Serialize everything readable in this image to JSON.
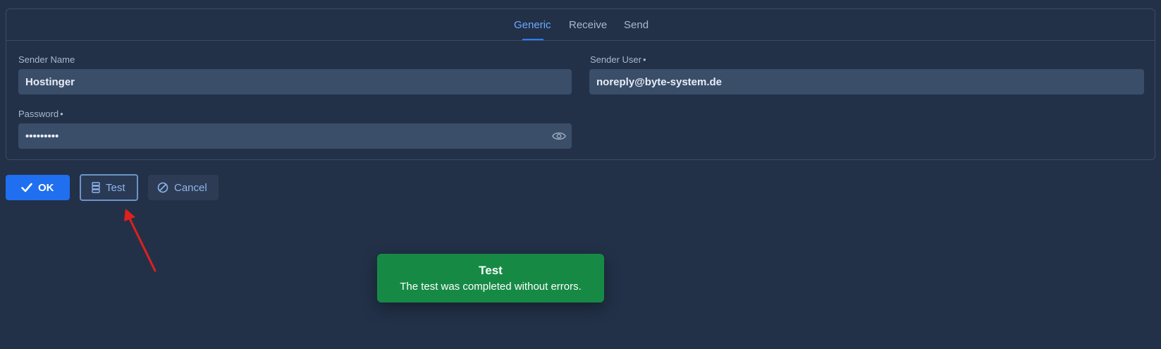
{
  "tabs": [
    {
      "label": "Generic",
      "active": true
    },
    {
      "label": "Receive",
      "active": false
    },
    {
      "label": "Send",
      "active": false
    }
  ],
  "form": {
    "sender_name": {
      "label": "Sender Name",
      "value": "Hostinger"
    },
    "sender_user": {
      "label": "Sender User",
      "required_marker": "•",
      "value": "noreply@byte-system.de"
    },
    "password": {
      "label": "Password",
      "required_marker": "•",
      "value": "•••••••••",
      "icon": "eye-icon"
    }
  },
  "buttons": {
    "ok": {
      "label": "OK",
      "icon": "check-icon"
    },
    "test": {
      "label": "Test",
      "icon": "server-icon"
    },
    "cancel": {
      "label": "Cancel",
      "icon": "ban-icon"
    }
  },
  "toast": {
    "title": "Test",
    "message": "The test was completed without errors."
  },
  "colors": {
    "background": "#223148",
    "accent": "#1f6ff0",
    "toast": "#168a45",
    "annotation_arrow": "#e0201e"
  }
}
